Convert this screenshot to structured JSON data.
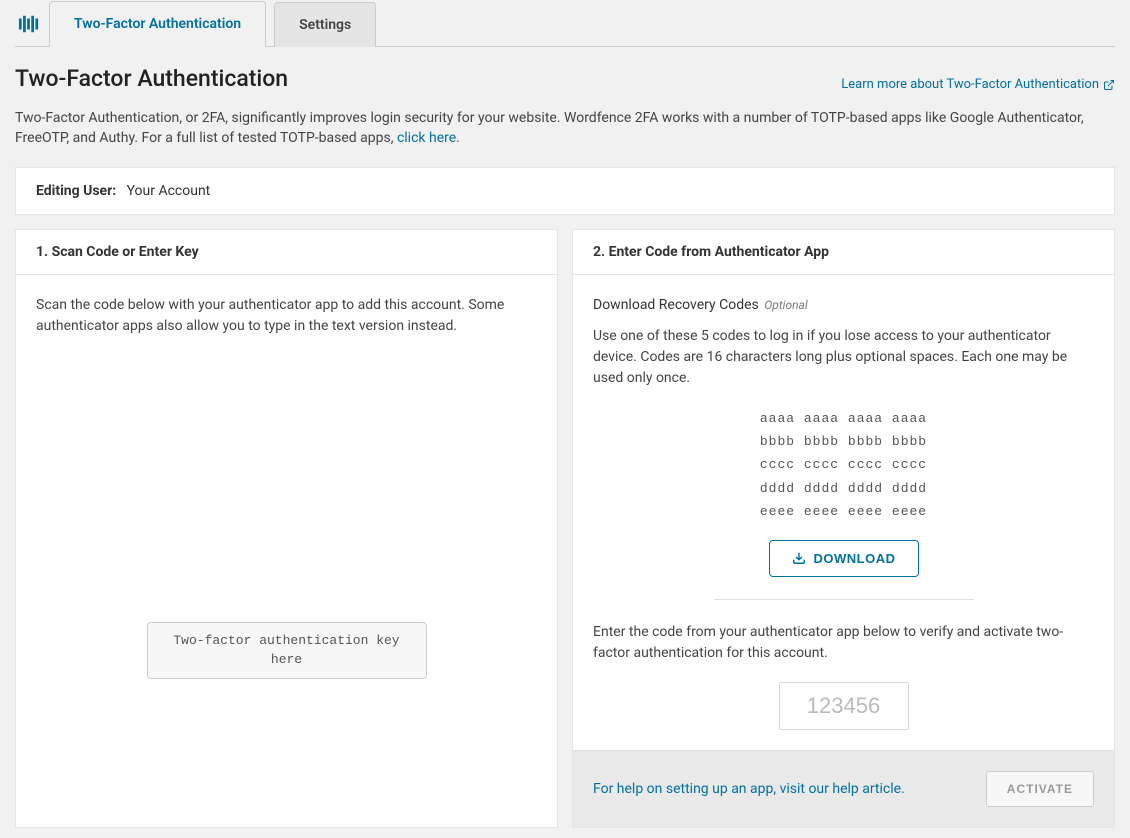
{
  "tabs": {
    "twofa": "Two-Factor Authentication",
    "settings": "Settings"
  },
  "page_title": "Two-Factor Authentication",
  "learn_more": "Learn more about Two-Factor Authentication",
  "intro_1": "Two-Factor Authentication, or 2FA, significantly improves login security for your website. Wordfence 2FA works with a number of TOTP-based apps like Google Authenticator, FreeOTP, and Authy. For a full list of tested TOTP-based apps, ",
  "intro_link": "click here",
  "intro_2": ".",
  "editing_label": "Editing User:",
  "editing_value": "Your Account",
  "left": {
    "header": "1. Scan Code or Enter Key",
    "desc": "Scan the code below with your authenticator app to add this account. Some authenticator apps also allow you to type in the text version instead.",
    "key": "Two-factor authentication key here"
  },
  "right": {
    "header": "2. Enter Code from Authenticator App",
    "recovery_label": "Download Recovery Codes",
    "optional": "Optional",
    "recovery_desc": "Use one of these 5 codes to log in if you lose access to your authenticator device. Codes are 16 characters long plus optional spaces. Each one may be used only once.",
    "codes": [
      "aaaa aaaa aaaa aaaa",
      "bbbb bbbb bbbb bbbb",
      "cccc cccc cccc cccc",
      "dddd dddd dddd dddd",
      "eeee eeee eeee eeee"
    ],
    "download": "DOWNLOAD",
    "enter_desc": "Enter the code from your authenticator app below to verify and activate two-factor authentication for this account.",
    "placeholder": "123456",
    "help": "For help on setting up an app, visit our help article.",
    "activate": "ACTIVATE"
  }
}
